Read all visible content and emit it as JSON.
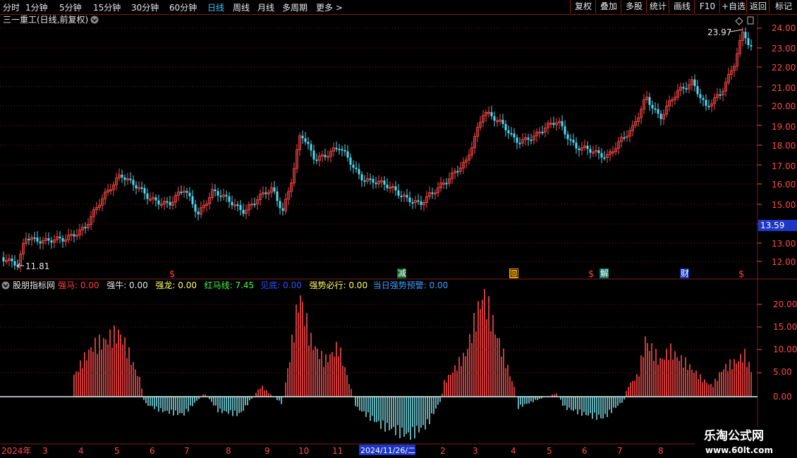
{
  "toolbar": {
    "left_items": [
      "分时",
      "1分钟",
      "5分钟",
      "15分钟",
      "30分钟",
      "60分钟",
      "日线",
      "周线",
      "月线",
      "多周期",
      "更多 >"
    ],
    "active_item": "日线",
    "right_items": [
      "复权",
      "叠加",
      "多股",
      "统计",
      "画线",
      "F10",
      "+自选",
      "返回"
    ]
  },
  "main_chart": {
    "title": "三一重工(日线,前复权)",
    "y_ticks": [
      "24.00",
      "23.00",
      "22.00",
      "21.00",
      "20.00",
      "19.00",
      "18.00",
      "17.00",
      "16.00",
      "15.00",
      "14.00",
      "13.00",
      "12.00"
    ],
    "current_price_label": "13.59",
    "high_label": "23.97",
    "low_label": "11.81",
    "signal_markers": [
      "$",
      "减",
      "回",
      "$",
      "解",
      "财",
      "$"
    ],
    "colors": {
      "up": "#ff4a4a",
      "down": "#54d9f0",
      "grid": "#7a1b1b"
    }
  },
  "indicator": {
    "name": "股朋指标网",
    "fields": [
      {
        "label": "强马: 0.00",
        "color": "#ff4040"
      },
      {
        "label": "强牛: 0.00",
        "color": "#e6e6e6"
      },
      {
        "label": "强龙: 0.00",
        "color": "#ffff60"
      },
      {
        "label": "红马线: 7.45",
        "color": "#40ff40"
      },
      {
        "label": "见底: 0.00",
        "color": "#3050ff"
      },
      {
        "label": "强势必行: 0.00",
        "color": "#ffff60"
      },
      {
        "label": "当日强势预警: 0.00",
        "color": "#3aa0ff"
      }
    ],
    "y_ticks": [
      "20.00",
      "15.00",
      "10.00",
      "5.00",
      "0.00"
    ]
  },
  "date_axis": {
    "labels": [
      "2024年",
      "3",
      "4",
      "5",
      "6",
      "7",
      "8",
      "9",
      "10",
      "11",
      "2024/11/26/二",
      "2",
      "3",
      "4",
      "5",
      "6",
      "7",
      "8"
    ]
  },
  "watermark": {
    "title": "乐淘公式网",
    "url": "www.60lt.com"
  }
}
